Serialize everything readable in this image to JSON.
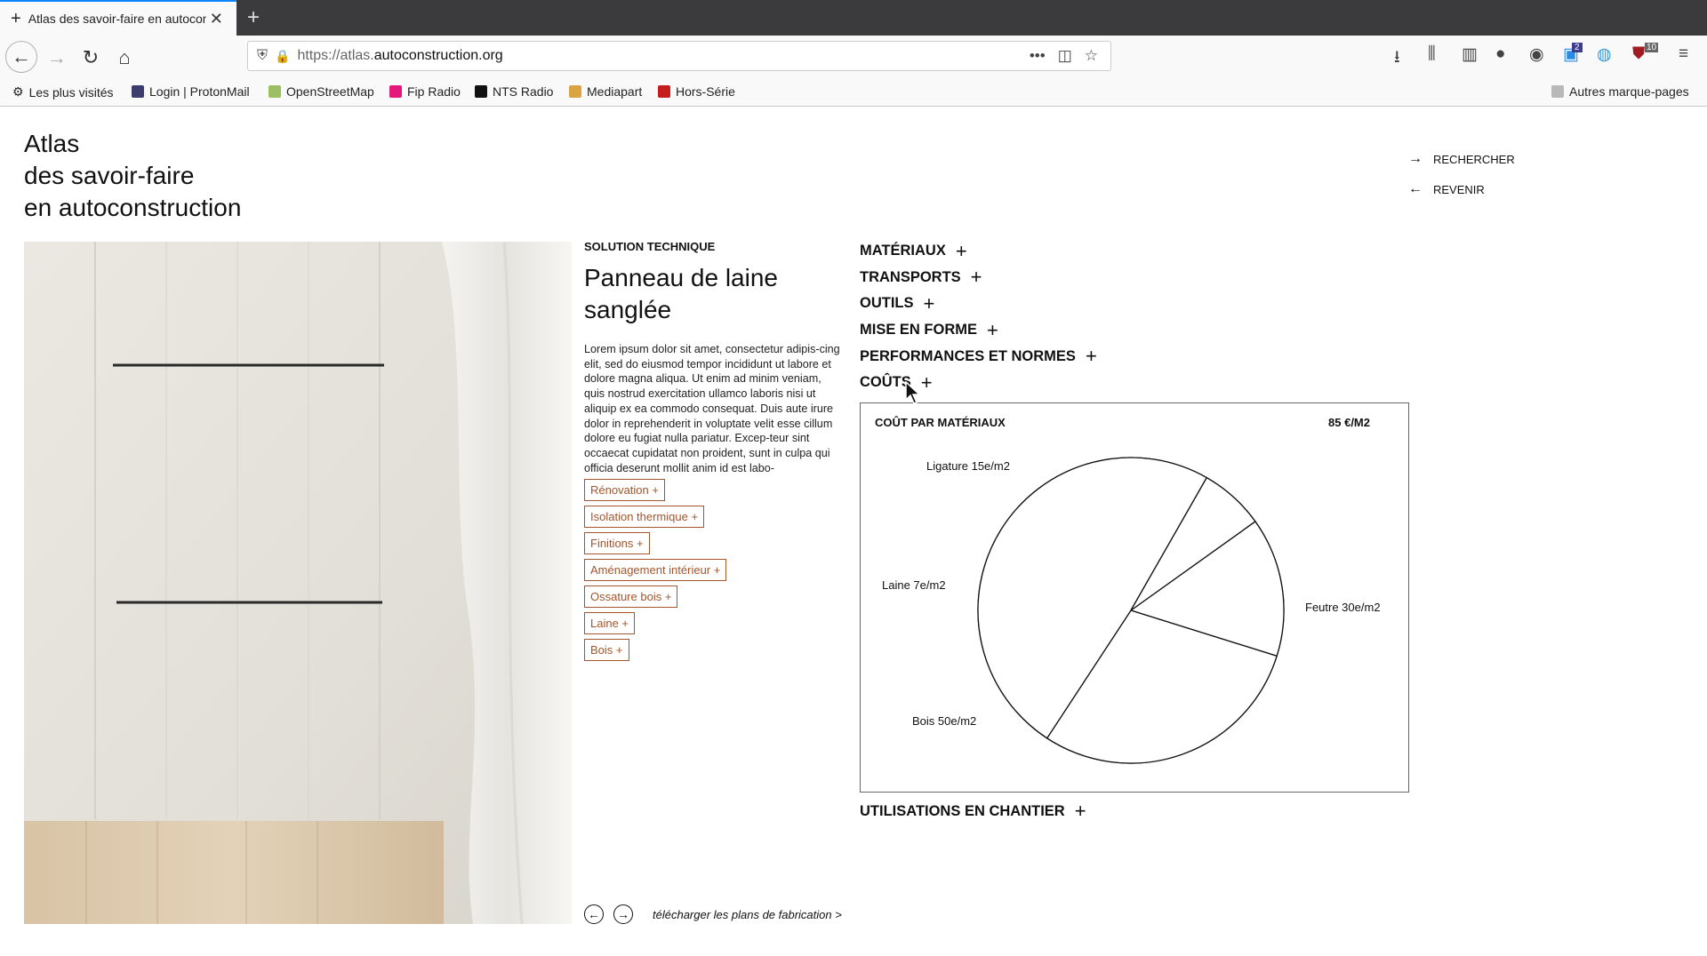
{
  "browser": {
    "tab_title": "Atlas des savoir-faire en autoconstruction",
    "url_prefix": "https://atlas.",
    "url_domain": "autoconstruction.org",
    "bookmarks": [
      "Les plus visités",
      "Login | ProtonMail",
      "OpenStreetMap",
      "Fip Radio",
      "NTS Radio",
      "Mediapart",
      "Hors-Série"
    ],
    "other_bookmarks": "Autres marque-pages",
    "badge_count_1": "2",
    "badge_count_2": "10"
  },
  "site": {
    "title_lines": [
      "Atlas",
      "des savoir-faire",
      "en autoconstruction"
    ],
    "nav": {
      "search": "RECHERCHER",
      "back": "REVENIR"
    }
  },
  "article": {
    "eyebrow": "SOLUTION TECHNIQUE",
    "title": "Panneau de laine sanglée",
    "body": "Lorem ipsum dolor sit amet, consectetur adipis-cing elit, sed do eiusmod tempor incididunt ut labore et dolore magna aliqua. Ut enim ad minim veniam, quis nostrud exercitation ullamco laboris nisi ut aliquip ex ea commodo consequat. Duis aute irure dolor in reprehenderit in voluptate velit esse cillum dolore eu fugiat nulla pariatur. Excep-teur sint occaecat cupidatat non proident, sunt in culpa qui officia deserunt mollit anim id est labo-",
    "tags": [
      "Rénovation +",
      "Isolation thermique +",
      "Finitions +",
      "Aménagement intérieur +",
      "Ossature bois +",
      "Laine +",
      "Bois +"
    ],
    "download": "télécharger les plans de fabrication >"
  },
  "sections": [
    "MATÉRIAUX",
    "TRANSPORTS",
    "OUTILS",
    "MISE EN FORME",
    "PERFORMANCES ET NORMES",
    "COÛTS"
  ],
  "section_bottom": "UTILISATIONS EN CHANTIER",
  "cost": {
    "title": "COÛT PAR MATÉRIAUX",
    "total": "85 €/M2"
  },
  "chart_data": {
    "type": "pie",
    "title": "COÛT PAR MATÉRIAUX",
    "slices": [
      {
        "label": "Ligature 15e/m2",
        "value": 15
      },
      {
        "label": "Feutre 30e/m2",
        "value": 30
      },
      {
        "label": "Bois 50e/m2",
        "value": 50
      },
      {
        "label": "Laine 7e/m2",
        "value": 7
      }
    ]
  },
  "colors": {
    "tag_border": "#a4552b",
    "tab_accent": "#0a84ff"
  }
}
